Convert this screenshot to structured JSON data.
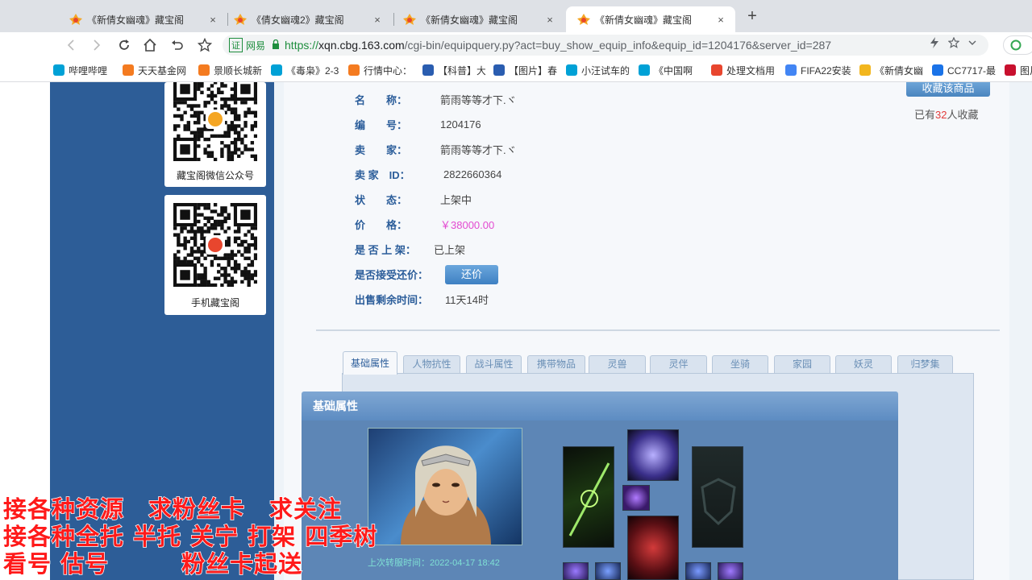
{
  "browser": {
    "tabs": [
      {
        "title": "《新倩女幽魂》藏宝阁",
        "active": false
      },
      {
        "title": "《倩女幽魂2》藏宝阁",
        "active": false
      },
      {
        "title": "《新倩女幽魂》藏宝阁",
        "active": false
      },
      {
        "title": "《新倩女幽魂》藏宝阁",
        "active": true
      }
    ],
    "close_glyph": "×",
    "newtab_glyph": "+",
    "omnibox": {
      "badge": "网易",
      "scheme": "https://",
      "domain": "xqn.cbg.163.com",
      "path": "/cgi-bin/equipquery.py?act=buy_show_equip_info&equip_id=1204176&server_id=287"
    },
    "bookmarks": [
      {
        "label": "哔哩哔哩",
        "color": "#00a1d6"
      },
      {
        "label": "天天基金网",
        "color": "#f47b20"
      },
      {
        "label": "景顺长城新",
        "color": "#f47b20"
      },
      {
        "label": "《毒枭》2-3",
        "color": "#00a1d6"
      },
      {
        "label": "行情中心：",
        "color": "#f47b20"
      },
      {
        "label": "【科普】大",
        "color": "#2a5db0"
      },
      {
        "label": "【图片】春",
        "color": "#2a5db0"
      },
      {
        "label": "小汪试车的",
        "color": "#00a1d6"
      },
      {
        "label": "《中国啊",
        "color": "#00a1d6"
      },
      {
        "label": "处理文档用",
        "color": "#e8462e"
      },
      {
        "label": "FIFA22安装",
        "color": "#4285f4"
      },
      {
        "label": "《新倩女幽",
        "color": "#f2b61e"
      },
      {
        "label": "CC7717-最",
        "color": "#1a73e8"
      },
      {
        "label": "图片",
        "color": "#c8102e"
      }
    ]
  },
  "sidebar": {
    "wechat_caption": "藏宝阁微信公众号",
    "mobile_caption": "手机藏宝阁"
  },
  "item": {
    "rows": [
      {
        "label": "名　　称：",
        "value": "箭雨等等才下.ヾ"
      },
      {
        "label": "编　　号：",
        "value": "1204176"
      },
      {
        "label": "卖　　家：",
        "value": "箭雨等等才下.ヾ"
      },
      {
        "label": "卖 家　ID：",
        "value": "2822660364"
      },
      {
        "label": "状　　态：",
        "value": "上架中"
      },
      {
        "label": "价　　格：",
        "value": "￥38000.00"
      },
      {
        "label": "是 否 上 架：",
        "value": "已上架"
      },
      {
        "label": "是否接受还价：",
        "value": ""
      },
      {
        "label": "出售剩余时间：",
        "value": "11天14时"
      }
    ],
    "bargain_button": "还价",
    "collect_button": "收藏该商品",
    "collect_prefix": "已有",
    "collect_count": "32",
    "collect_suffix": "人收藏"
  },
  "detail_tabs": [
    "基础属性",
    "人物抗性",
    "战斗属性",
    "携带物品",
    "灵兽",
    "灵伴",
    "坐骑",
    "家园",
    "妖灵",
    "归梦集"
  ],
  "panel": {
    "heading": "基础属性",
    "last_login": "上次转服时间：2022-04-17 18:42"
  },
  "overlay": {
    "line1": "接各种资源　求粉丝卡　求关注",
    "line2": "接各种全托 半托 关宁 打架 四季树",
    "line3": "看号 估号　　　粉丝卡起送"
  }
}
